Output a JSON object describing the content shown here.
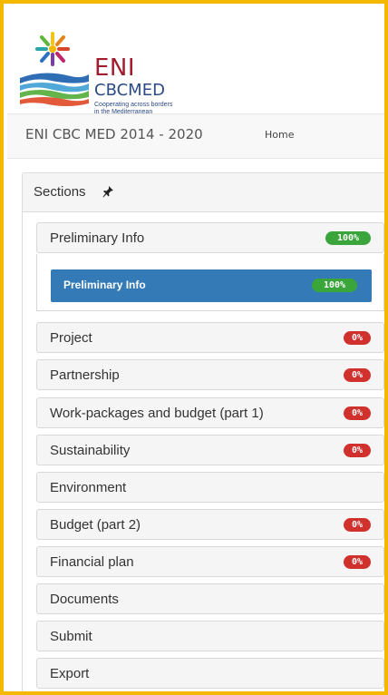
{
  "logo": {
    "name_top": "ENI",
    "name_bottom": "CBCMED",
    "tagline_1": "Cooperating across borders",
    "tagline_2": "in the Mediterranean"
  },
  "navbar": {
    "brand": "ENI CBC MED 2014 - 2020",
    "home": "Home"
  },
  "panel": {
    "title": "Sections",
    "pin_icon": "pin-icon"
  },
  "sections": [
    {
      "label": "Preliminary Info",
      "badge": "100%",
      "badge_color": "#3aa53a"
    },
    {
      "label": "Project",
      "badge": "0%",
      "badge_color": "#d0312d"
    },
    {
      "label": "Partnership",
      "badge": "0%",
      "badge_color": "#d0312d"
    },
    {
      "label": "Work-packages and budget (part 1)",
      "badge": "0%",
      "badge_color": "#d0312d"
    },
    {
      "label": "Sustainability",
      "badge": "0%",
      "badge_color": "#d0312d"
    },
    {
      "label": "Environment",
      "badge": ""
    },
    {
      "label": "Budget (part 2)",
      "badge": "0%",
      "badge_color": "#d0312d"
    },
    {
      "label": "Financial plan",
      "badge": "0%",
      "badge_color": "#d0312d"
    },
    {
      "label": "Documents",
      "badge": ""
    },
    {
      "label": "Submit",
      "badge": ""
    },
    {
      "label": "Export",
      "badge": ""
    }
  ],
  "sub_section": {
    "label": "Preliminary Info",
    "badge": "100%",
    "background": "#337ab7"
  },
  "colors": {
    "frame_border": "#f5b800",
    "active_blue": "#337ab7",
    "success_green": "#3aa53a",
    "danger_red": "#d0312d"
  }
}
